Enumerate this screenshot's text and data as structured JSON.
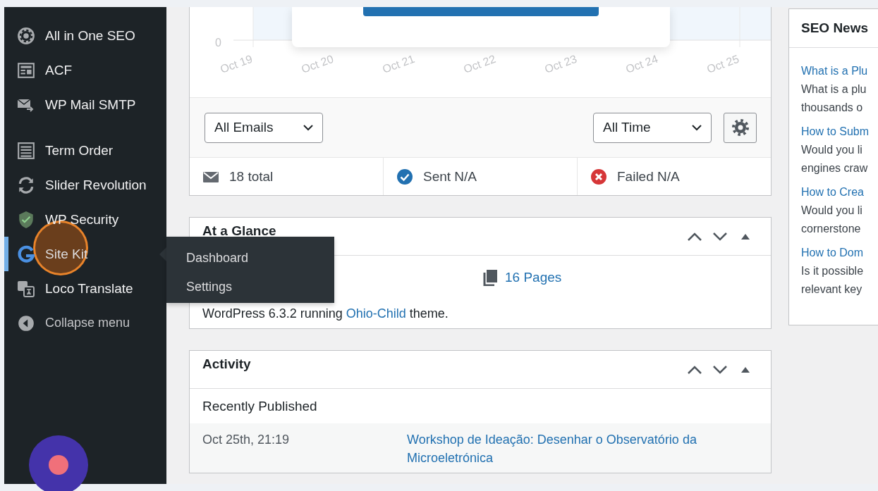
{
  "sidebar": {
    "groups": [
      {
        "items": [
          {
            "label": "All in One SEO",
            "selected": false
          },
          {
            "label": "ACF",
            "selected": false
          },
          {
            "label": "WP Mail SMTP",
            "selected": false
          }
        ]
      },
      {
        "items": [
          {
            "label": "Term Order",
            "selected": false
          },
          {
            "label": "Slider Revolution",
            "selected": false
          },
          {
            "label": "WP Security",
            "selected": false
          },
          {
            "label": "Site Kit",
            "selected": true
          },
          {
            "label": "Loco Translate",
            "selected": false
          }
        ]
      }
    ],
    "collapse_label": "Collapse menu",
    "flyout": {
      "items": [
        {
          "label": "Dashboard"
        },
        {
          "label": "Settings"
        }
      ]
    }
  },
  "email_chart": {
    "y_tick": "0",
    "x_labels": [
      "Oct 19",
      "Oct 20",
      "Oct 21",
      "Oct 22",
      "Oct 23",
      "Oct 24",
      "Oct 25"
    ]
  },
  "email_filters": {
    "type_select": "All Emails",
    "period_select": "All Time"
  },
  "email_stats": [
    {
      "kind": "total",
      "label": "18 total"
    },
    {
      "kind": "sent",
      "label": "Sent N/A"
    },
    {
      "kind": "failed",
      "label": "Failed N/A"
    }
  ],
  "at_a_glance": {
    "title": "At a Glance",
    "pages": "16 Pages",
    "version_text": "WordPress 6.3.2 running",
    "theme_link": "Ohio-Child",
    "theme_suffix": "theme."
  },
  "activity": {
    "title": "Activity",
    "section": "Recently Published",
    "rows": [
      {
        "date": "Oct 25th, 21:19",
        "title": "Workshop de Ideação: Desenhar o Observatório da Microeletrónica"
      }
    ]
  },
  "seo_news": {
    "title": "SEO News",
    "items": [
      {
        "title": "What is a Plu",
        "lines": [
          "What is a plu",
          "thousands o"
        ]
      },
      {
        "title": "How to Subm",
        "lines": [
          "Would you li",
          "engines craw"
        ]
      },
      {
        "title": "How to Crea",
        "lines": [
          "Would you li",
          "cornerstone"
        ]
      },
      {
        "title": "How to Dom",
        "lines": [
          "Is it possible",
          "relevant key"
        ]
      }
    ]
  }
}
